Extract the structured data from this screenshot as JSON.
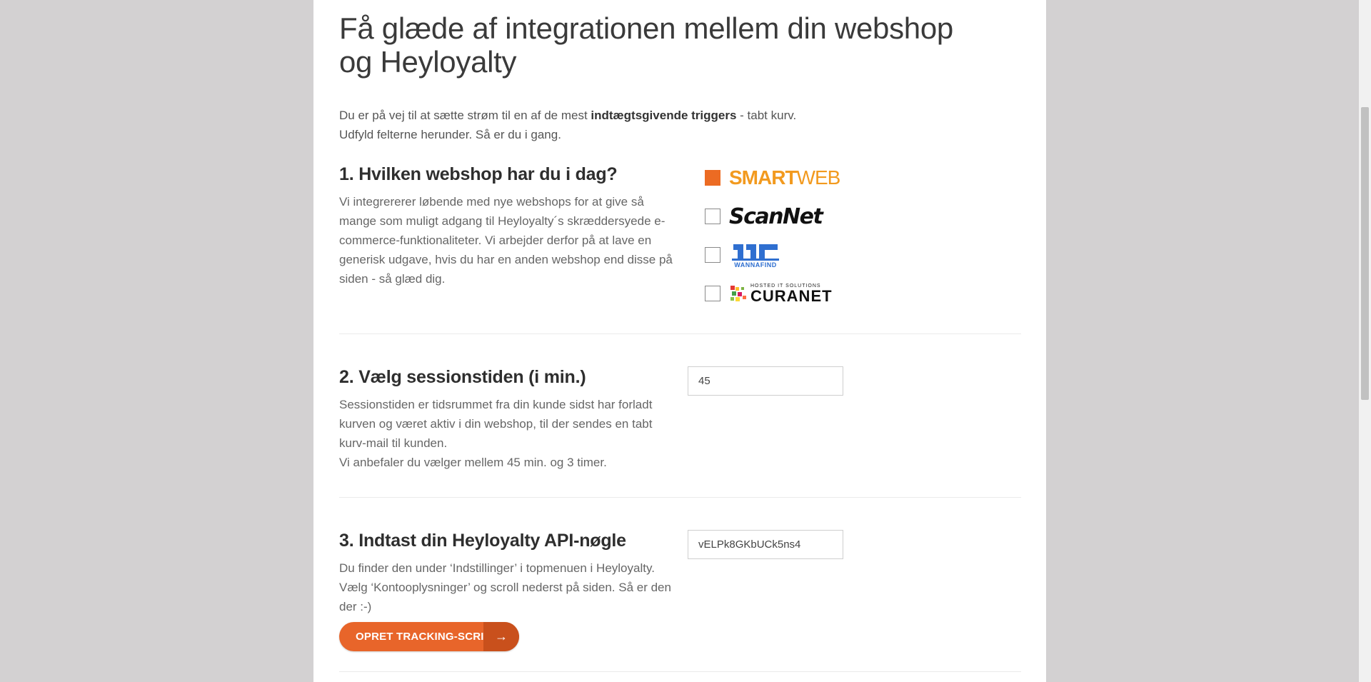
{
  "header": {
    "title": "Få glæde af integrationen mellem din webshop og Heyloyalty"
  },
  "intro": {
    "line1_pre": "Du er på vej til at sætte strøm til en af de mest ",
    "line1_bold": "indtægtsgivende triggers",
    "line1_post": " - tabt kurv.",
    "line2": "Udfyld felterne herunder. Så er du i gang."
  },
  "section1": {
    "title": "1. Hvilken webshop har du i dag?",
    "text": "Vi integrererer løbende med nye webshops for at give så mange som muligt adgang til Heyloyalty´s skræddersyede e-commerce-funktionaliteter. Vi arbejder derfor på at lave en generisk udgave, hvis du har en anden webshop end disse på siden - så glæd dig.",
    "shops": [
      {
        "name": "SMARTWEB",
        "name_bold": "SMART",
        "name_light": "WEB",
        "checked": true
      },
      {
        "name": "ScanNet",
        "checked": false
      },
      {
        "name": "WANNAFIND",
        "checked": false
      },
      {
        "name": "CURANET",
        "tagline": "HOSTED IT SOLUTIONS",
        "checked": false
      }
    ]
  },
  "section2": {
    "title": "2. Vælg sessionstiden (i min.)",
    "text": "Sessionstiden er tidsrummet fra din kunde sidst har forladt kurven og været aktiv i din webshop, til der sendes en tabt kurv-mail til kunden.",
    "text2": "Vi anbefaler du vælger mellem 45 min. og 3 timer.",
    "input_value": "45"
  },
  "section3": {
    "title": "3. Indtast din Heyloyalty API-nøgle",
    "text": "Du finder den under ‘Indstillinger’ i topmenuen i Heyloyalty. Vælg ‘Kontooplysninger’ og scroll nederst på siden. Så er den der :-)",
    "input_value": "vELPk8GKbUCk5ns4",
    "button_label": "OPRET TRACKING-SCRIPT",
    "button_icon": "arrow-right-icon"
  },
  "colors": {
    "accent": "#e8652a",
    "accent_dark": "#c9501c",
    "smartweb": "#f29a1f",
    "wannafind": "#2f6fd0"
  }
}
